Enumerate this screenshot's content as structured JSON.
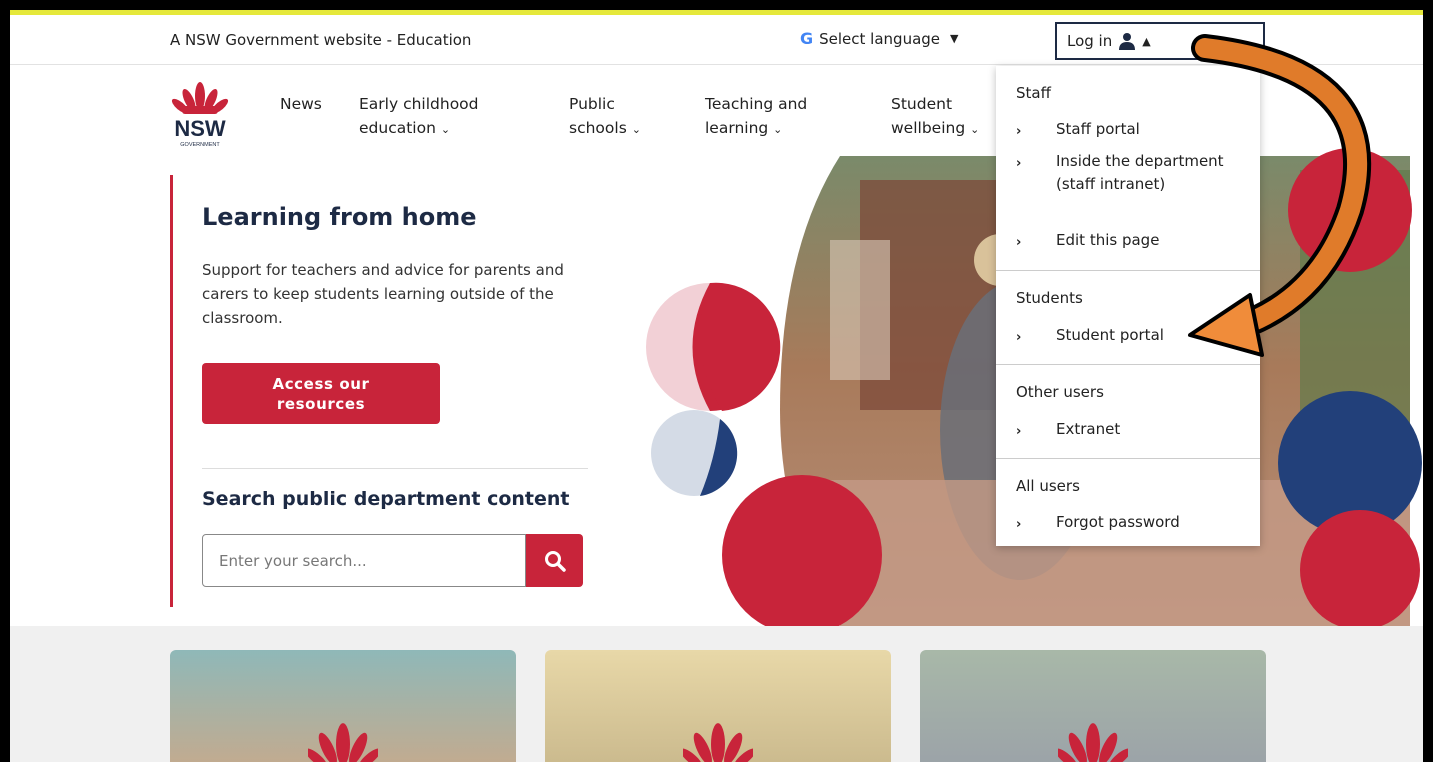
{
  "topbar": {
    "gov_text": "A NSW Government website - Education",
    "language_label": "Select language",
    "login_label": "Log in"
  },
  "logo": {
    "wordmark": "NSW",
    "sub": "GOVERNMENT"
  },
  "nav": {
    "items": [
      {
        "label_1": "News",
        "label_2": ""
      },
      {
        "label_1": "Early childhood",
        "label_2": "education"
      },
      {
        "label_1": "Public",
        "label_2": "schools"
      },
      {
        "label_1": "Teaching and",
        "label_2": "learning"
      },
      {
        "label_1": "Student",
        "label_2": "wellbeing"
      }
    ]
  },
  "hero": {
    "title": "Learning from home",
    "description": "Support for teachers and advice for parents and carers to keep students learning outside of the classroom.",
    "cta_line1": "Access our",
    "cta_line2": "resources",
    "search_title": "Search public department content",
    "search_placeholder": "Enter your search..."
  },
  "dropdown": {
    "sections": [
      {
        "heading": "Staff",
        "items": [
          "Staff portal",
          "Inside the department (staff intranet)",
          "Edit this page"
        ]
      },
      {
        "heading": "Students",
        "items": [
          "Student portal"
        ]
      },
      {
        "heading": "Other users",
        "items": [
          "Extranet"
        ]
      },
      {
        "heading": "All users",
        "items": [
          "Forgot password"
        ]
      }
    ]
  },
  "colors": {
    "brand_red": "#c8243a",
    "brand_navy": "#1d2a44",
    "accent_yellow": "#e5e83b",
    "arrow_orange": "#e07b2a"
  },
  "icons": {
    "google": "google-g-icon",
    "user": "user-icon",
    "search": "search-icon",
    "chevron_down": "chevron-down-icon",
    "chevron_up": "chevron-up-icon",
    "chevron_right": "chevron-right-icon",
    "waratah": "waratah-logo"
  }
}
